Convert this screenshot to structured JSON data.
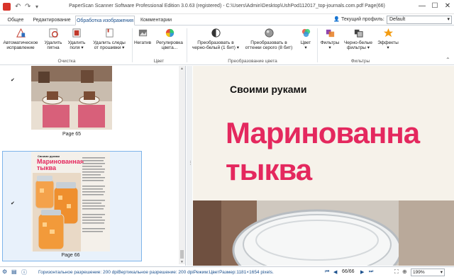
{
  "window": {
    "title": "PaperScan Scanner Software Professional Edition 3.0.63 (registered) - C:\\Users\\Admin\\Desktop\\UshPod112017_top-journals.com.pdf Page(66)",
    "minimize": "—",
    "maximize": "☐",
    "close": "✕"
  },
  "quick_access": {
    "undo": "↶",
    "redo": "↷",
    "more": "▾"
  },
  "tabs": [
    {
      "label": "Общее"
    },
    {
      "label": "Редактирование"
    },
    {
      "label": "Обработка изображения"
    },
    {
      "label": "Комментарии"
    }
  ],
  "active_tab": "Обработка изображения",
  "profile": {
    "label": "Текущий профиль:",
    "value": "Default"
  },
  "ribbon": {
    "groups": {
      "cleanup": "Очистка",
      "color": "Цвет",
      "color_transform": "Преобразование цвета",
      "filters": "Фильтры"
    },
    "buttons": {
      "auto_enhance": [
        "Автоматическое",
        "исправление"
      ],
      "remove_spots": [
        "Удалить",
        "пятна"
      ],
      "remove_margins": [
        "Удалить",
        "поля ▾"
      ],
      "remove_staples": [
        "Удалить следы",
        "от прошивки ▾"
      ],
      "negative": [
        "Негатив"
      ],
      "color_adjust": [
        "Регулировка",
        "цвета..."
      ],
      "to_bw": [
        "Преобразовать в",
        "черно-белый (1 бит) ▾"
      ],
      "to_gray": [
        "Преобразовать в",
        "оттенки серого (8 бит)"
      ],
      "color": [
        "Цвет",
        "▾"
      ],
      "filters": [
        "Фильтры",
        "▾"
      ],
      "bw_filters": [
        "Черно-белые",
        "фильтры ▾"
      ],
      "effects": [
        "Эффекты",
        "▾"
      ]
    }
  },
  "thumbnails": [
    {
      "label": "Page 65",
      "checked": "✔"
    },
    {
      "label": "Page 66",
      "checked": "✔",
      "heading": "Маринованная тыква",
      "kicker": "Своими руками"
    }
  ],
  "preview": {
    "kicker": "Своими руками",
    "line1": "Маринованна",
    "line2": "тыква"
  },
  "statusbar": {
    "text": "Горизонтальное разрешение: 200 dpiВертикальное разрешение: 200 dpiРежим:ЦветРазмер:1181×1654 pixels.",
    "page_indicator": "66/66",
    "zoom": "199%",
    "nav_first": "⏮",
    "nav_prev": "◀",
    "nav_next": "▶",
    "nav_last": "⏭"
  },
  "colors": {
    "accent": "#1a4f8c",
    "headline": "#e4285e",
    "app_icon": "#d8342a"
  }
}
